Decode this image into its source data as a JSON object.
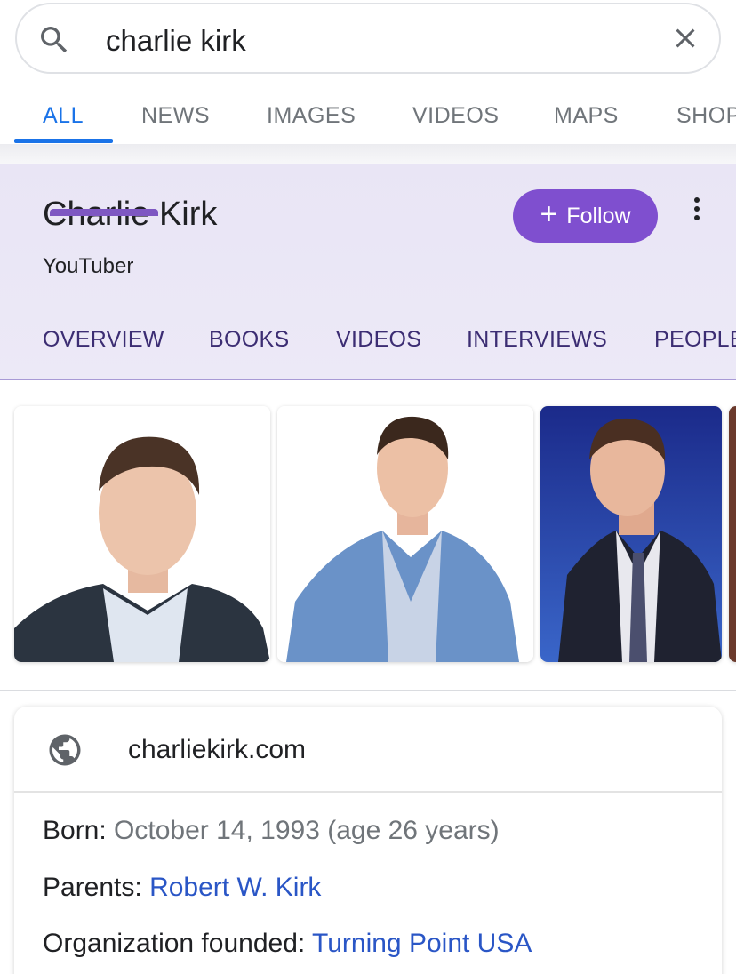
{
  "search": {
    "query": "charlie kirk"
  },
  "search_tabs": [
    "ALL",
    "NEWS",
    "IMAGES",
    "VIDEOS",
    "MAPS",
    "SHOP"
  ],
  "knowledge_panel": {
    "title": "Charlie Kirk",
    "subtitle": "YouTuber",
    "follow_plus": "+",
    "follow_label": "Follow",
    "tabs": [
      "OVERVIEW",
      "BOOKS",
      "VIDEOS",
      "INTERVIEWS",
      "PEOPLE"
    ]
  },
  "info": {
    "website": "charliekirk.com",
    "born_label": "Born: ",
    "born_value": "October 14, 1993 (age 26 years)",
    "parents_label": "Parents: ",
    "parents_value": "Robert W. Kirk",
    "org_label": "Organization founded: ",
    "org_value": "Turning Point USA"
  },
  "colors": {
    "accent_blue": "#1a73e8",
    "follow_purple": "#7f4fcf",
    "panel_bg": "#ebe7f6",
    "link_blue": "#2a56c6"
  }
}
